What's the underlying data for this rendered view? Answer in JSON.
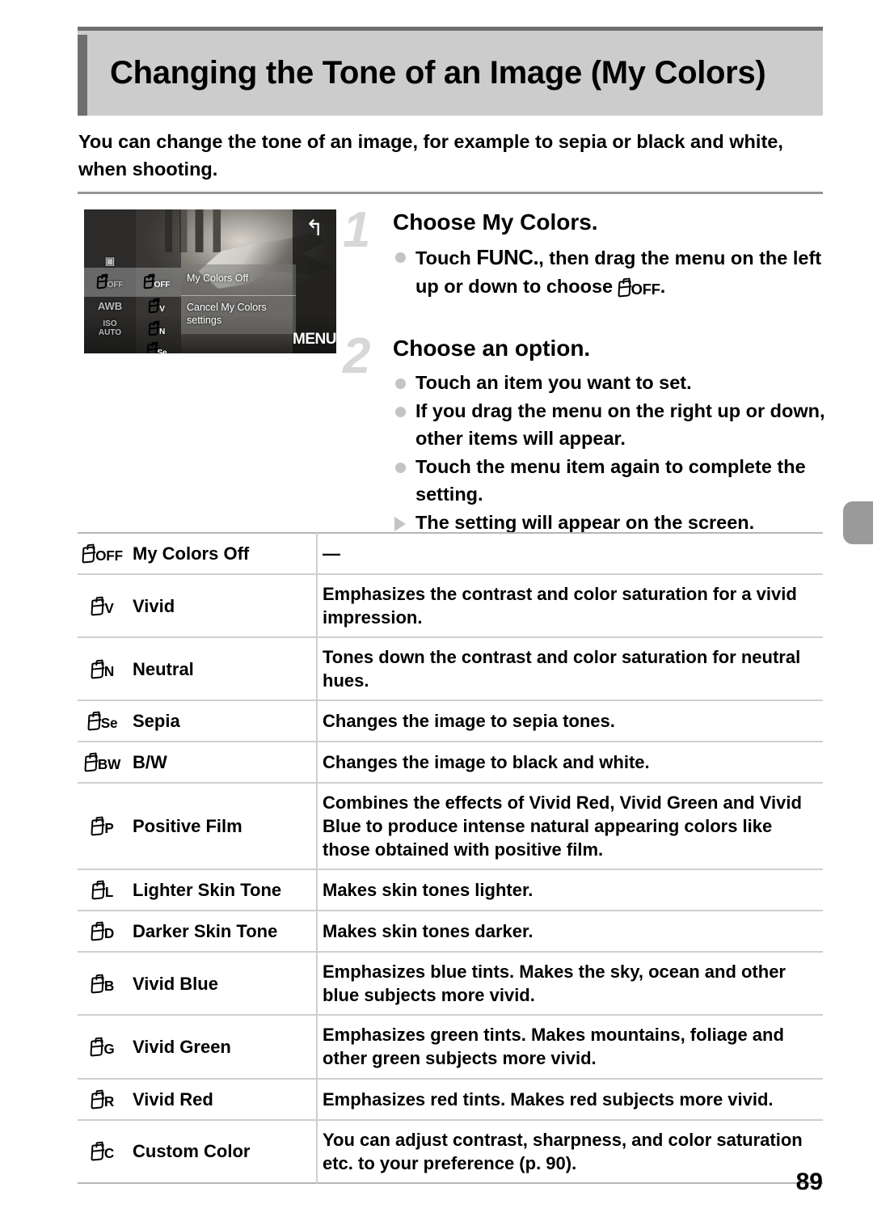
{
  "header": {
    "title": "Changing the Tone of an Image (My Colors)"
  },
  "intro": "You can change the tone of an image, for example to sepia or black and white, when shooting.",
  "figure": {
    "name": "camera-lcd-my-colors-menu",
    "left_column_icons": [
      "metering-icon",
      "OFF",
      "AWB",
      "ISO AUTO"
    ],
    "middle_column_icons": [
      "OFF",
      "V",
      "N",
      "Se"
    ],
    "panel_line_1": "My Colors Off",
    "panel_line_2": "Cancel My Colors settings",
    "back_button": "↰",
    "menu_button": "MENU"
  },
  "steps": [
    {
      "number": "1",
      "heading": "Choose My Colors.",
      "bullets": [
        {
          "marker": "dot",
          "before": "Touch ",
          "func": "FUNC.",
          "middle": ", then drag the menu on the left up or down to choose ",
          "icon_sub": "OFF",
          "after": "."
        }
      ]
    },
    {
      "number": "2",
      "heading": "Choose an option.",
      "bullets": [
        {
          "marker": "dot",
          "text": "Touch an item you want to set."
        },
        {
          "marker": "dot",
          "text": "If you drag the menu on the right up or down, other items will appear."
        },
        {
          "marker": "dot",
          "text": "Touch the menu item again to complete the setting."
        },
        {
          "marker": "triangle",
          "text": "The setting will appear on the screen."
        }
      ]
    }
  ],
  "table": {
    "rows": [
      {
        "icon_sub": "OFF",
        "name": "My Colors Off",
        "desc": "—"
      },
      {
        "icon_sub": "V",
        "name": "Vivid",
        "desc": "Emphasizes the contrast and color saturation for a vivid impression."
      },
      {
        "icon_sub": "N",
        "name": "Neutral",
        "desc": "Tones down the contrast and color saturation for neutral hues."
      },
      {
        "icon_sub": "Se",
        "name": "Sepia",
        "desc": "Changes the image to sepia tones."
      },
      {
        "icon_sub": "BW",
        "name": "B/W",
        "desc": "Changes the image to black and white."
      },
      {
        "icon_sub": "P",
        "name": "Positive Film",
        "desc": "Combines the effects of Vivid Red, Vivid Green and Vivid Blue to produce intense natural appearing colors like those obtained with positive film."
      },
      {
        "icon_sub": "L",
        "name": "Lighter Skin Tone",
        "desc": "Makes skin tones lighter."
      },
      {
        "icon_sub": "D",
        "name": "Darker Skin Tone",
        "desc": "Makes skin tones darker."
      },
      {
        "icon_sub": "B",
        "name": "Vivid Blue",
        "desc": "Emphasizes blue tints. Makes the sky, ocean and other blue subjects more vivid."
      },
      {
        "icon_sub": "G",
        "name": "Vivid Green",
        "desc": "Emphasizes green tints. Makes mountains, foliage and other green subjects more vivid."
      },
      {
        "icon_sub": "R",
        "name": "Vivid Red",
        "desc": "Emphasizes red tints. Makes red subjects more vivid."
      },
      {
        "icon_sub": "C",
        "name": "Custom Color",
        "desc": "You can adjust contrast, sharpness, and color saturation etc. to your preference (p. 90)."
      }
    ]
  },
  "page_number": "89",
  "colors": {
    "header_bg": "#cccccc",
    "header_accent": "#6e6e6e",
    "step_number": "#d7d7d7",
    "bullet": "#c4c4c4",
    "rule": "#969696",
    "table_line": "#cfcfcf",
    "edge_tab": "#9a9a9a"
  }
}
